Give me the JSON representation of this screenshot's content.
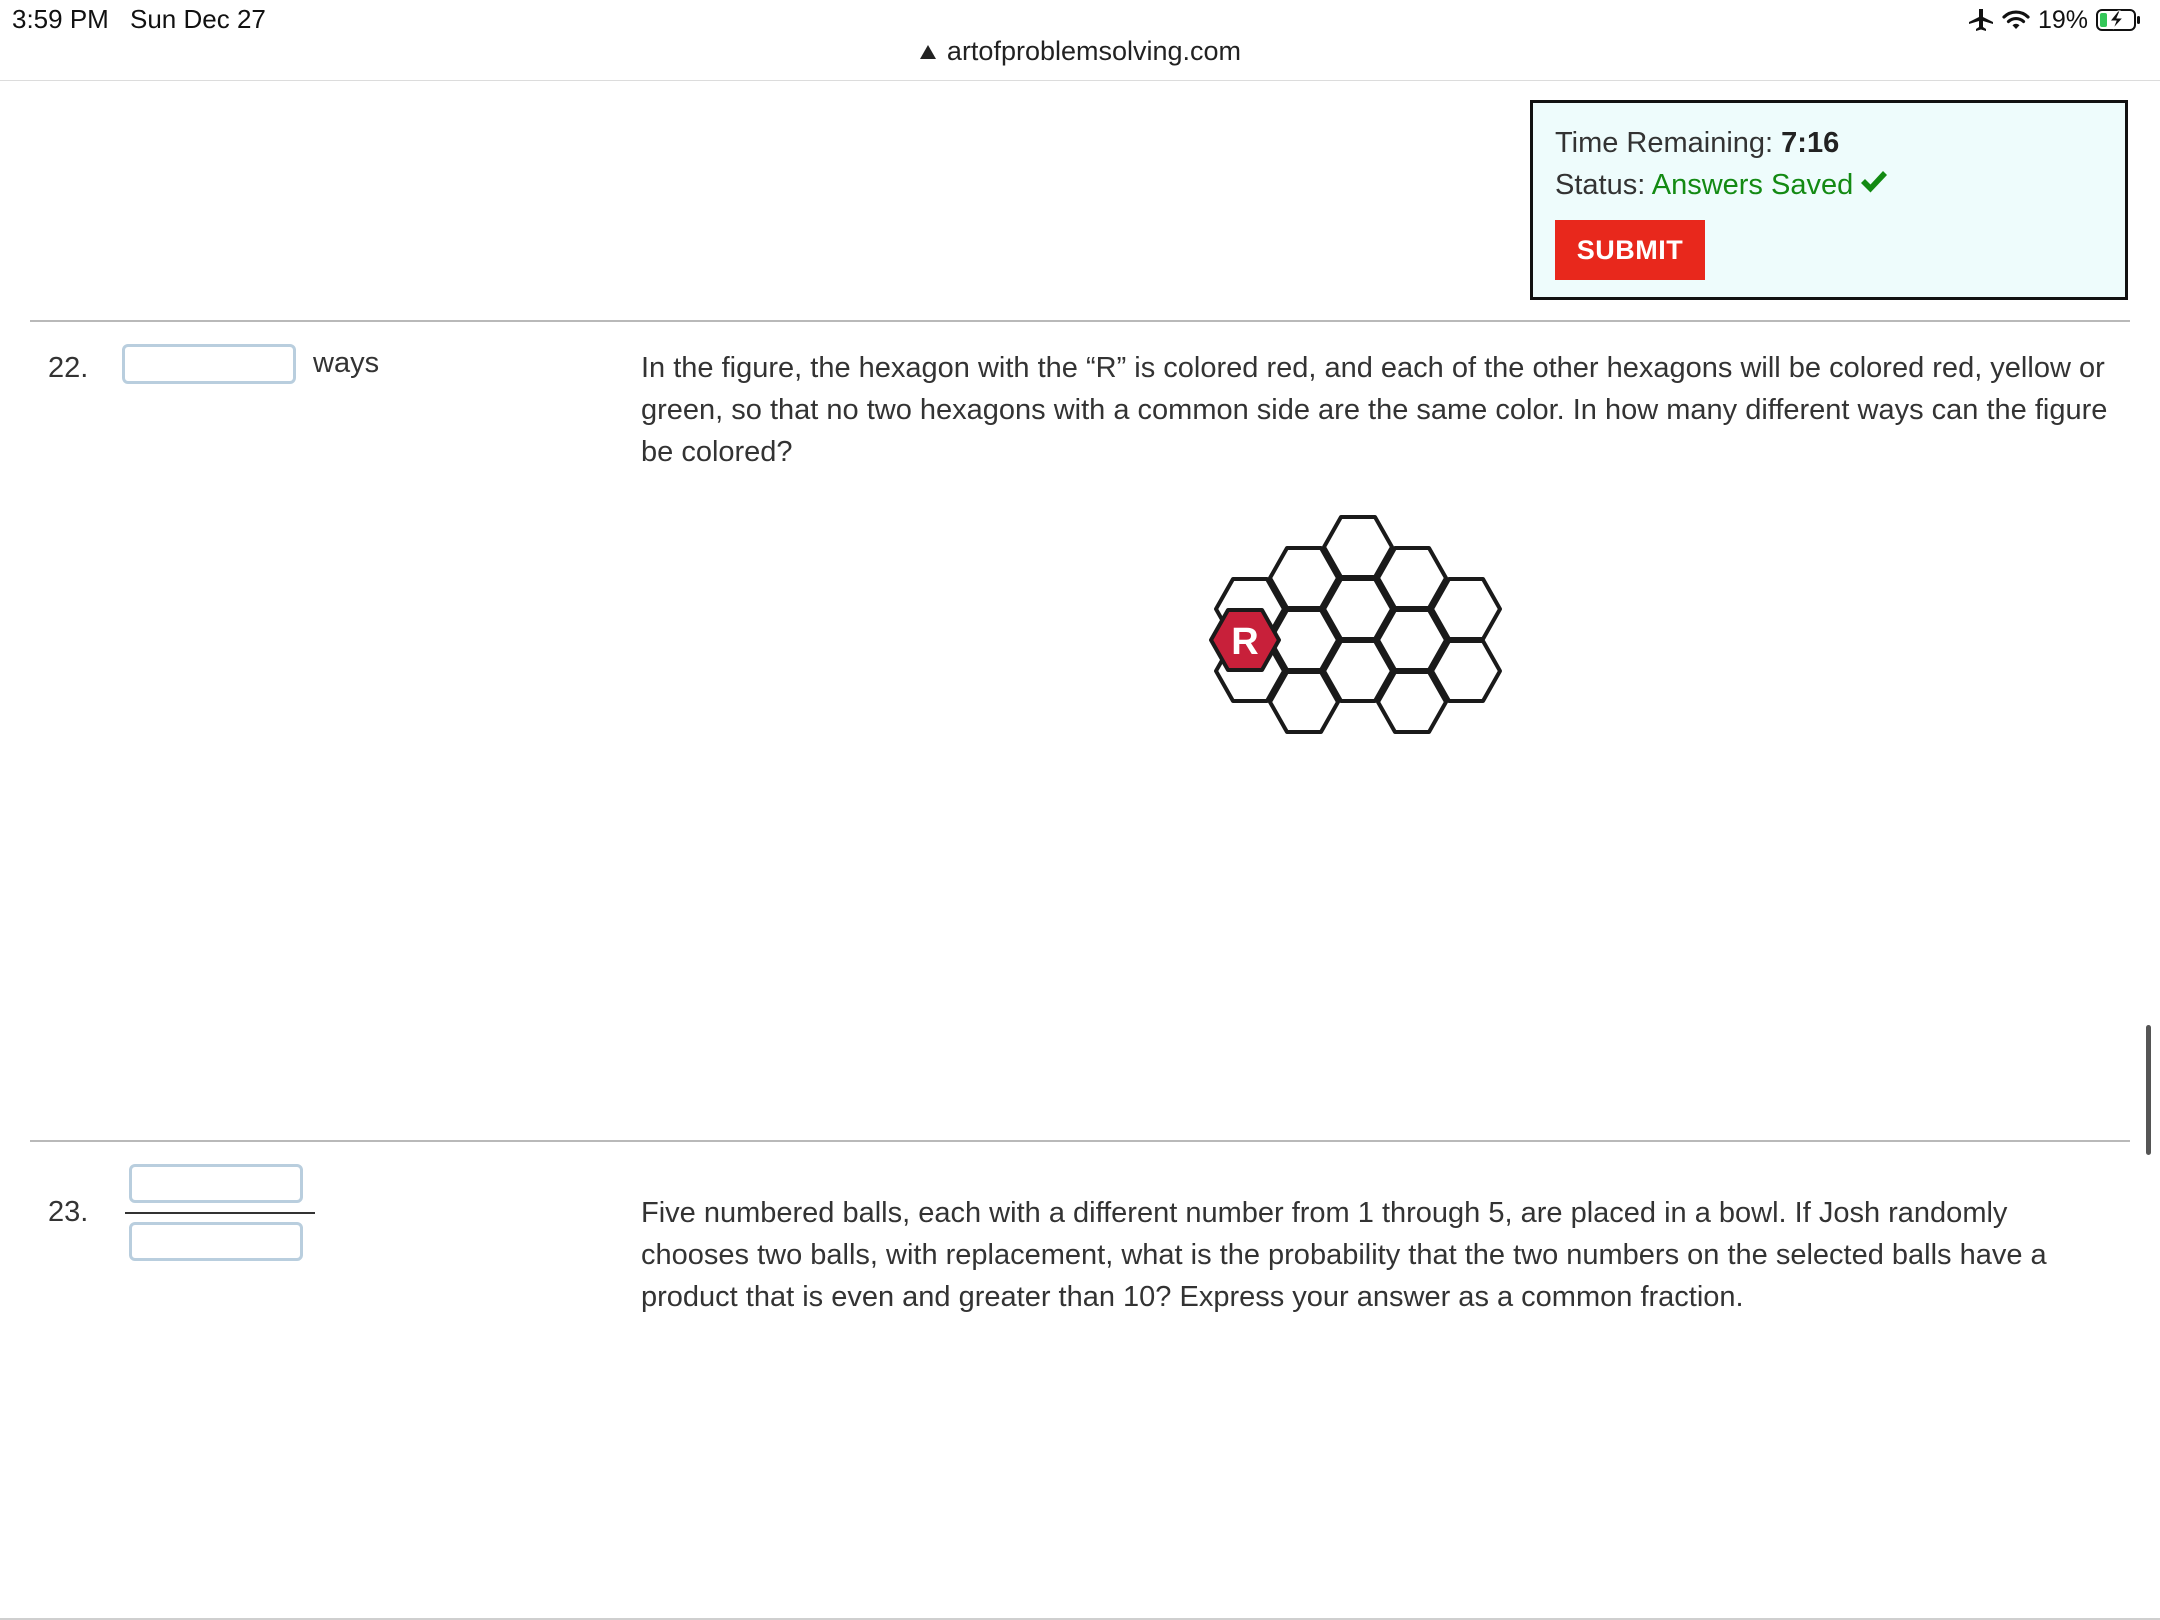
{
  "status_bar": {
    "time": "3:59 PM",
    "date": "Sun Dec 27",
    "battery_percent": "19%"
  },
  "browser": {
    "url": "artofproblemsolving.com"
  },
  "timer": {
    "time_label": "Time Remaining: ",
    "time_value": "7:16",
    "status_label": "Status: ",
    "status_value": "Answers Saved",
    "submit_label": "SUBMIT"
  },
  "questions": [
    {
      "number": "22.",
      "answer_unit": "ways",
      "text": "In the figure, the hexagon with the “R” is colored red, and each of the other hexagons will be colored red, yellow or green, so that no two hexagons with a common side are the same color. In how many different ways can the figure be colored?",
      "figure_label": "R"
    },
    {
      "number": "23.",
      "text": "Five numbered balls, each with a different number from 1 through 5, are placed in a bowl. If Josh randomly chooses two balls, with replacement, what is the probability that the two numbers on the selected balls have a product that is even and greater than 10? Express your answer as a common fraction."
    }
  ],
  "colors": {
    "submit": "#e8281c",
    "status_ok": "#138a13",
    "timer_bg": "#eefcfc",
    "red_hex": "#c8203a"
  }
}
